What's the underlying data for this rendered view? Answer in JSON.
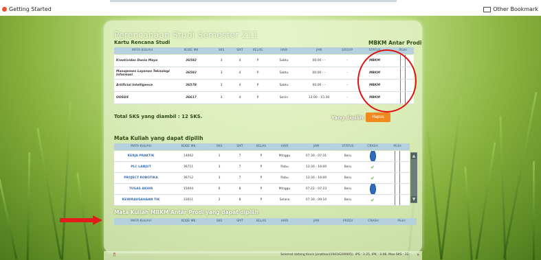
{
  "bookmarks": {
    "left_label": "Getting Started",
    "right_label": "Other Bookmark"
  },
  "page": {
    "title": "Perencanaan Studi Semester 211",
    "krs_title": "Kartu Rencana Studi",
    "mbkm_title": "MBKM Antar Prodi",
    "total_sks": "Total SKS yang diambil : 12 SKS.",
    "yang_dipilih": "Yang dipilih :",
    "hapus": "Hapus",
    "mk_title": "Mata Kuliah yang dapat dipilih",
    "mbkm_section_title": "Mata Kuliah MBKM Antar Prodi yang dapat dipilih",
    "footer_welcome": "Selamat datang Kevin Jonathan(19416200005). IPS : 3.25. IPK : 3.08. Max SKS : 22.",
    "up_arrow": "⇑",
    "chevron": "»"
  },
  "krs": {
    "headers": [
      "MATA KULIAH",
      "KODE MK",
      "SKS",
      "SMT",
      "KELAS",
      "HARI",
      "JAM",
      "GROUP",
      "STATUS",
      "PILIH"
    ],
    "rows": [
      [
        "Kreatividas Dunia Maya",
        "36582",
        "3",
        "4",
        "P",
        "Sabtu",
        "00:00 - -",
        "-",
        "MBKM"
      ],
      [
        "Manajemen Layanan Teknologi Informasi",
        "36583",
        "3",
        "4",
        "P",
        "Sabtu",
        "00:00 - -",
        "-",
        "MBKM"
      ],
      [
        "Artificial Intelligence",
        "36578",
        "3",
        "4",
        "P",
        "Sabtu",
        "00:00 - -",
        "-",
        "MBKM"
      ],
      [
        "OOSDX",
        "36617",
        "3",
        "4",
        "P",
        "Senin",
        "13:00 - 15:30",
        "-",
        "MBKM"
      ]
    ]
  },
  "mk": {
    "headers": [
      "MATA KULIAH",
      "KODE MK",
      "SKS",
      "SMT",
      "KELAS",
      "HARI",
      "JAM",
      "STATUS",
      "CRASH",
      "PILIH"
    ],
    "rows": [
      {
        "cells": [
          "KERJA PRAKTIK",
          "14002",
          "1",
          "7",
          "P",
          "Minggu",
          "07:30 - 07:31",
          "Baru"
        ],
        "crash": "stop"
      },
      {
        "cells": [
          "PLC LANJUT",
          "36711",
          "3",
          "7",
          "P",
          "Rabu",
          "13:30 - 16:00",
          "Baru"
        ],
        "crash": "ok"
      },
      {
        "cells": [
          "PROJECT ROBOTIKA",
          "36712",
          "3",
          "7",
          "P",
          "Rabu",
          "13:30 - 16:00",
          "Baru"
        ],
        "crash": "ok"
      },
      {
        "cells": [
          "TUGAS AKHIR",
          "15004",
          "6",
          "8",
          "P",
          "Minggu",
          "07:22 - 07:23",
          "Baru"
        ],
        "crash": "stop"
      },
      {
        "cells": [
          "KEWIRAUSAHAAN TIK",
          "33011",
          "2",
          "8",
          "P",
          "Selasa",
          "07:30 - 09:10",
          "Baru"
        ],
        "crash": "ok"
      }
    ]
  },
  "mbkm_available": {
    "headers": [
      "MATA KULIAH",
      "KODE MK",
      "SKS",
      "SMT",
      "KELAS",
      "HARI",
      "JAM",
      "PRODI",
      "CRASH",
      "PILIH"
    ]
  },
  "colors": {
    "annotation": "#e01010",
    "hapus_button": "#f08a20",
    "table_header": "#b6d1dd"
  }
}
